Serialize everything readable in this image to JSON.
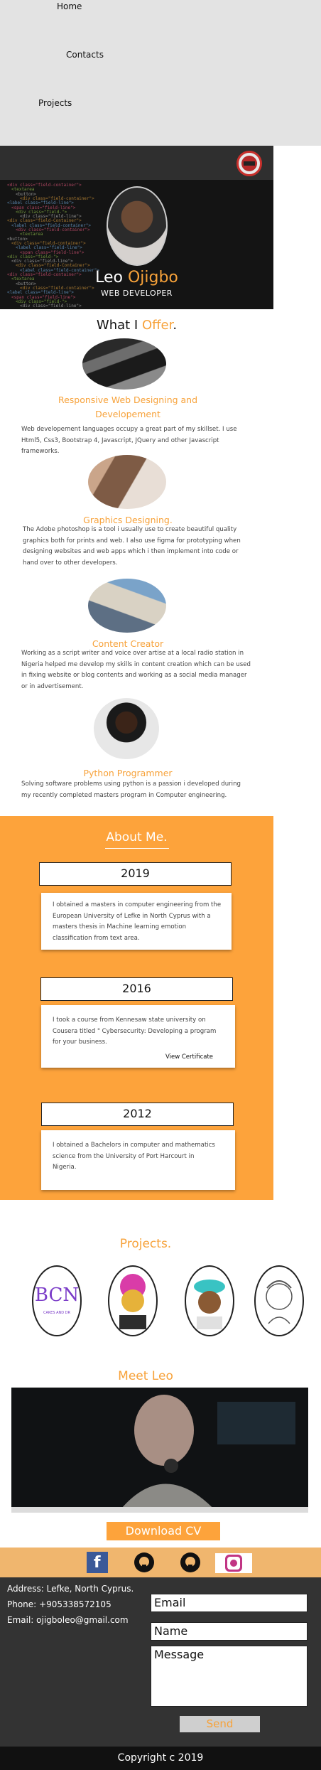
{
  "nav": {
    "items": [
      {
        "label": "Home"
      },
      {
        "label": "Contacts"
      },
      {
        "label": "Projects"
      }
    ]
  },
  "hero": {
    "name_first": "Leo ",
    "name_last": "Ojigbo",
    "role": "WEB DEVELOPER",
    "code_lines": [
      "<div class=\"field-container\">",
      "  <textarea",
      "<button>",
      "<div class=\"field-container\">",
      "  <label class=\"field-line\">",
      "<span class=\"field-line\">",
      "<div class=\"field-\">",
      "  <div class=\"field-line\">",
      "<div class=\"field-Container\">",
      "<label class=\"field-container\">"
    ]
  },
  "offer": {
    "title_a": "What I ",
    "title_b": "Offer",
    "title_c": ".",
    "items": [
      {
        "title": "Responsive Web Designing and Developement",
        "text": "Web developement languages occupy a great part of my skillset. I use Html5, Css3, Bootstrap 4, Javascript, JQuery and other Javascript frameworks."
      },
      {
        "title": "Graphics Designing.",
        "text": "The Adobe photoshop is a tool i usually use to create beautiful quality graphics both for prints and web. I also use figma for prototyping when designing websites and web apps which i then implement into code or hand over to other developers."
      },
      {
        "title": "Content Creator",
        "text": "Working as a script writer and voice over artise at a local radio station in Nigeria helped me develop my skills in content creation which can be used in fixing website or blog contents and  working as a social media manager or in advertisement."
      },
      {
        "title": "Python Programmer",
        "text": "Solving software problems using python is a passion i developed during my recently completed masters program in Computer engineering."
      }
    ]
  },
  "about": {
    "title": "About Me.",
    "entries": [
      {
        "year": "2019",
        "text": "I obtained a masters in computer engineering from the European University of Lefke in North Cyprus with a masters thesis in Machine learning emotion classification from text area."
      },
      {
        "year": "2016",
        "text": "I took a course from Kennesaw state university on Cousera titled \" Cybersecurity: Developing a program for your business.",
        "link": "View Certificate"
      },
      {
        "year": "2012",
        "text": "I obtained a Bachelors in computer and mathematics science from the University of Port Harcourt in Nigeria."
      }
    ]
  },
  "projects": {
    "title": "Projects.",
    "items": [
      {
        "name": "bgn-cakes-logo",
        "label": "BCN",
        "sub": "CAKES AND DR"
      },
      {
        "name": "woman-illustration",
        "label": ""
      },
      {
        "name": "man-cap-illustration",
        "label": ""
      },
      {
        "name": "man-phone-sketch",
        "label": ""
      }
    ]
  },
  "meet": {
    "title": "Meet Leo",
    "cv_label": "Download CV"
  },
  "social": [
    {
      "name": "facebook-icon"
    },
    {
      "name": "github-icon"
    },
    {
      "name": "github-icon"
    },
    {
      "name": "instagram-icon"
    }
  ],
  "contact": {
    "address": "Address: Lefke, North Cyprus.",
    "phone": "Phone: +905338572105",
    "email": "Email: ojigboleo@gmail.com",
    "email_placeholder": "Email",
    "name_placeholder": "Name",
    "message_placeholder": "Message",
    "send_label": "Send"
  },
  "footer": {
    "copyright": "Copyright c 2019"
  },
  "colors": {
    "accent": "#f7a23a",
    "about_bg": "#fda33b",
    "footer_bg": "#333333"
  }
}
